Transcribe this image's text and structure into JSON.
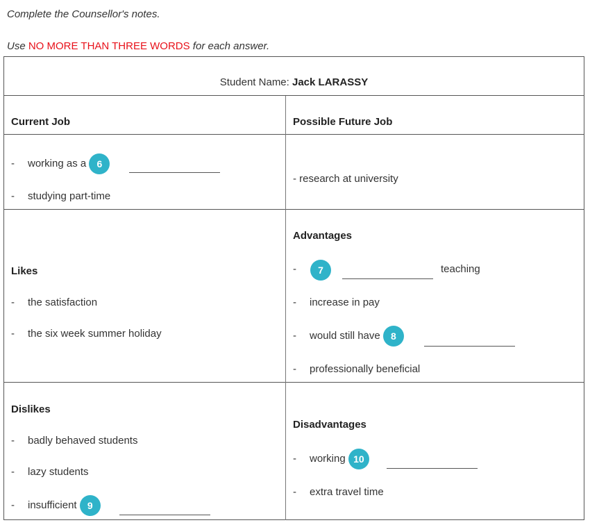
{
  "instructions": {
    "line1": "Complete the Counsellor's notes.",
    "line2_prefix": "Use ",
    "line2_highlight": "NO MORE THAN THREE WORDS",
    "line2_suffix": " for each answer."
  },
  "header": {
    "label": "Student Name: ",
    "name": "Jack LARASSY"
  },
  "current_job": {
    "title": "Current Job",
    "item1_prefix": "working as a",
    "item1_q": "6",
    "item2": "studying part-time"
  },
  "future_job": {
    "title": "Possible Future Job",
    "item1": "- research at university"
  },
  "likes": {
    "title": "Likes",
    "items": [
      "the satisfaction",
      "the six week summer holiday"
    ]
  },
  "advantages": {
    "title": "Advantages",
    "q7": "7",
    "item1_suffix": "teaching",
    "item2": "increase in pay",
    "item3_prefix": "would still have",
    "q8": "8",
    "item4": "professionally beneficial"
  },
  "dislikes": {
    "title": "Dislikes",
    "items": [
      "badly behaved students",
      "lazy students"
    ],
    "item3_prefix": "insufficient",
    "q9": "9"
  },
  "disadvantages": {
    "title": "Disadvantages",
    "item1_prefix": "working",
    "q10": "10",
    "item2": "extra travel time"
  },
  "dash": "-",
  "colors": {
    "accent": "#2fb3c9",
    "highlight": "#e8111a",
    "border": "#555555"
  }
}
